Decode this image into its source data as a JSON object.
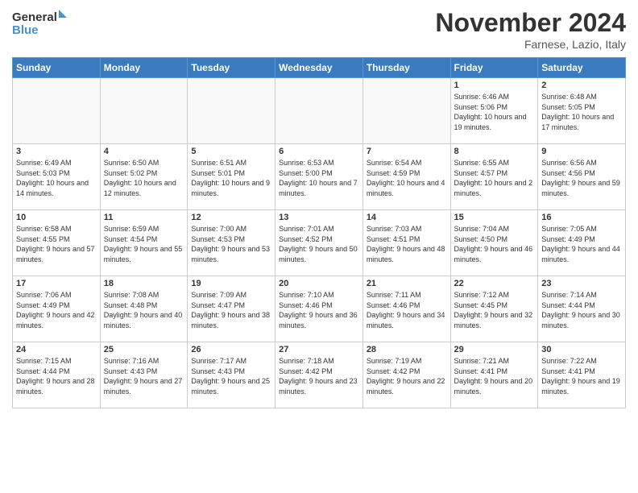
{
  "logo": {
    "line1": "General",
    "line2": "Blue"
  },
  "title": "November 2024",
  "location": "Farnese, Lazio, Italy",
  "days_header": [
    "Sunday",
    "Monday",
    "Tuesday",
    "Wednesday",
    "Thursday",
    "Friday",
    "Saturday"
  ],
  "weeks": [
    [
      {
        "day": "",
        "info": ""
      },
      {
        "day": "",
        "info": ""
      },
      {
        "day": "",
        "info": ""
      },
      {
        "day": "",
        "info": ""
      },
      {
        "day": "",
        "info": ""
      },
      {
        "day": "1",
        "info": "Sunrise: 6:46 AM\nSunset: 5:06 PM\nDaylight: 10 hours and 19 minutes."
      },
      {
        "day": "2",
        "info": "Sunrise: 6:48 AM\nSunset: 5:05 PM\nDaylight: 10 hours and 17 minutes."
      }
    ],
    [
      {
        "day": "3",
        "info": "Sunrise: 6:49 AM\nSunset: 5:03 PM\nDaylight: 10 hours and 14 minutes."
      },
      {
        "day": "4",
        "info": "Sunrise: 6:50 AM\nSunset: 5:02 PM\nDaylight: 10 hours and 12 minutes."
      },
      {
        "day": "5",
        "info": "Sunrise: 6:51 AM\nSunset: 5:01 PM\nDaylight: 10 hours and 9 minutes."
      },
      {
        "day": "6",
        "info": "Sunrise: 6:53 AM\nSunset: 5:00 PM\nDaylight: 10 hours and 7 minutes."
      },
      {
        "day": "7",
        "info": "Sunrise: 6:54 AM\nSunset: 4:59 PM\nDaylight: 10 hours and 4 minutes."
      },
      {
        "day": "8",
        "info": "Sunrise: 6:55 AM\nSunset: 4:57 PM\nDaylight: 10 hours and 2 minutes."
      },
      {
        "day": "9",
        "info": "Sunrise: 6:56 AM\nSunset: 4:56 PM\nDaylight: 9 hours and 59 minutes."
      }
    ],
    [
      {
        "day": "10",
        "info": "Sunrise: 6:58 AM\nSunset: 4:55 PM\nDaylight: 9 hours and 57 minutes."
      },
      {
        "day": "11",
        "info": "Sunrise: 6:59 AM\nSunset: 4:54 PM\nDaylight: 9 hours and 55 minutes."
      },
      {
        "day": "12",
        "info": "Sunrise: 7:00 AM\nSunset: 4:53 PM\nDaylight: 9 hours and 53 minutes."
      },
      {
        "day": "13",
        "info": "Sunrise: 7:01 AM\nSunset: 4:52 PM\nDaylight: 9 hours and 50 minutes."
      },
      {
        "day": "14",
        "info": "Sunrise: 7:03 AM\nSunset: 4:51 PM\nDaylight: 9 hours and 48 minutes."
      },
      {
        "day": "15",
        "info": "Sunrise: 7:04 AM\nSunset: 4:50 PM\nDaylight: 9 hours and 46 minutes."
      },
      {
        "day": "16",
        "info": "Sunrise: 7:05 AM\nSunset: 4:49 PM\nDaylight: 9 hours and 44 minutes."
      }
    ],
    [
      {
        "day": "17",
        "info": "Sunrise: 7:06 AM\nSunset: 4:49 PM\nDaylight: 9 hours and 42 minutes."
      },
      {
        "day": "18",
        "info": "Sunrise: 7:08 AM\nSunset: 4:48 PM\nDaylight: 9 hours and 40 minutes."
      },
      {
        "day": "19",
        "info": "Sunrise: 7:09 AM\nSunset: 4:47 PM\nDaylight: 9 hours and 38 minutes."
      },
      {
        "day": "20",
        "info": "Sunrise: 7:10 AM\nSunset: 4:46 PM\nDaylight: 9 hours and 36 minutes."
      },
      {
        "day": "21",
        "info": "Sunrise: 7:11 AM\nSunset: 4:46 PM\nDaylight: 9 hours and 34 minutes."
      },
      {
        "day": "22",
        "info": "Sunrise: 7:12 AM\nSunset: 4:45 PM\nDaylight: 9 hours and 32 minutes."
      },
      {
        "day": "23",
        "info": "Sunrise: 7:14 AM\nSunset: 4:44 PM\nDaylight: 9 hours and 30 minutes."
      }
    ],
    [
      {
        "day": "24",
        "info": "Sunrise: 7:15 AM\nSunset: 4:44 PM\nDaylight: 9 hours and 28 minutes."
      },
      {
        "day": "25",
        "info": "Sunrise: 7:16 AM\nSunset: 4:43 PM\nDaylight: 9 hours and 27 minutes."
      },
      {
        "day": "26",
        "info": "Sunrise: 7:17 AM\nSunset: 4:43 PM\nDaylight: 9 hours and 25 minutes."
      },
      {
        "day": "27",
        "info": "Sunrise: 7:18 AM\nSunset: 4:42 PM\nDaylight: 9 hours and 23 minutes."
      },
      {
        "day": "28",
        "info": "Sunrise: 7:19 AM\nSunset: 4:42 PM\nDaylight: 9 hours and 22 minutes."
      },
      {
        "day": "29",
        "info": "Sunrise: 7:21 AM\nSunset: 4:41 PM\nDaylight: 9 hours and 20 minutes."
      },
      {
        "day": "30",
        "info": "Sunrise: 7:22 AM\nSunset: 4:41 PM\nDaylight: 9 hours and 19 minutes."
      }
    ]
  ]
}
